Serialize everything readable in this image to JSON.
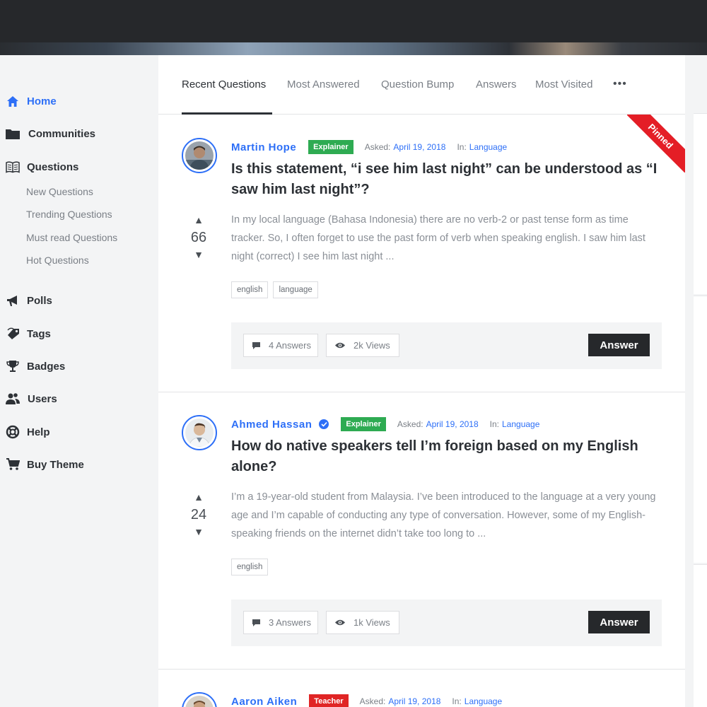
{
  "sidebar": {
    "items": [
      {
        "label": "Home",
        "icon": "home-icon"
      },
      {
        "label": "Communities",
        "icon": "folder-icon"
      },
      {
        "label": "Questions",
        "icon": "book-icon"
      },
      {
        "label": "Polls",
        "icon": "megaphone-icon"
      },
      {
        "label": "Tags",
        "icon": "tag-icon"
      },
      {
        "label": "Badges",
        "icon": "trophy-icon"
      },
      {
        "label": "Users",
        "icon": "users-icon"
      },
      {
        "label": "Help",
        "icon": "lifebuoy-icon"
      },
      {
        "label": "Buy Theme",
        "icon": "cart-icon"
      }
    ],
    "sub_items": [
      "New Questions",
      "Trending Questions",
      "Must read Questions",
      "Hot Questions"
    ]
  },
  "tabs": [
    "Recent Questions",
    "Most Answered",
    "Question Bump",
    "Answers",
    "Most Visited"
  ],
  "tabs_more": "•••",
  "labels": {
    "asked": "Asked:",
    "in": "In:",
    "answer_button": "Answer",
    "pinned": "Pinned"
  },
  "colors": {
    "accent": "#2d6ff7",
    "explainer_badge": "#2eab52",
    "teacher_badge": "#e02525",
    "pinned_ribbon": "#e41e26",
    "dark": "#26282b"
  },
  "questions": [
    {
      "author": "Martin Hope",
      "badge": "Explainer",
      "date": "April 19, 2018",
      "category": "Language",
      "title": "Is this statement, “i see him last night” can be understood as “I saw him last night”?",
      "excerpt": "In my local language (Bahasa Indonesia) there are no verb-2 or past tense form as time tracker. So, I often forget to use the past form of verb when speaking english. I saw him last night (correct) I see him last night ...",
      "votes": "66",
      "tags": [
        "english",
        "language"
      ],
      "answers": "4 Answers",
      "views": "2k Views",
      "pinned": true
    },
    {
      "author": "Ahmed Hassan",
      "verified": true,
      "badge": "Explainer",
      "date": "April 19, 2018",
      "category": "Language",
      "title": "How do native speakers tell I’m foreign based on my English alone?",
      "excerpt": "I’m a 19-year-old student from Malaysia. I’ve been introduced to the language at a very young age and I’m capable of conducting any type of conversation. However, some of my English-speaking friends on the internet didn’t take too long to ...",
      "votes": "24",
      "tags": [
        "english"
      ],
      "answers": "3 Answers",
      "views": "1k Views"
    },
    {
      "author": "Aaron Aiken",
      "badge": "Teacher",
      "date": "April 19, 2018",
      "category": "Language"
    }
  ]
}
